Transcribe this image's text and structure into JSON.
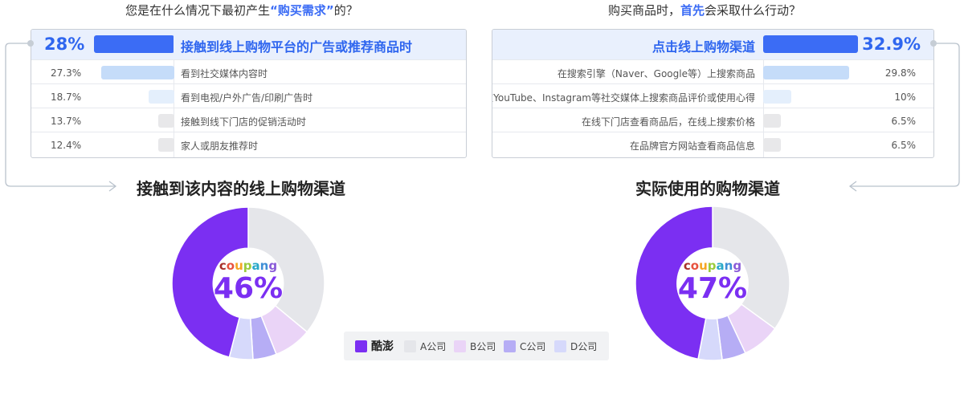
{
  "left": {
    "question_parts": [
      "您是在什么情况下最初产生",
      "“购买需求”",
      "的？"
    ],
    "top": {
      "pct": "28%",
      "value": 28,
      "label": "接触到线上购物平台的广告或推荐商品时"
    },
    "rows": [
      {
        "pct": "27.3%",
        "value": 27.3,
        "label": "看到社交媒体内容时"
      },
      {
        "pct": "18.7%",
        "value": 18.7,
        "label": "看到电视/户外广告/印刷广告时"
      },
      {
        "pct": "13.7%",
        "value": 13.7,
        "label": "接触到线下门店的促销活动时"
      },
      {
        "pct": "12.4%",
        "value": 12.4,
        "label": "家人或朋友推荐时"
      }
    ],
    "donut_title": "接触到该内容的线上购物渠道",
    "center_pct": "46%"
  },
  "right": {
    "question_parts": [
      "购买商品时，",
      "首先",
      "会采取什么行动？"
    ],
    "top": {
      "pct": "32.9%",
      "value": 32.9,
      "label": "点击线上购物渠道"
    },
    "rows": [
      {
        "pct": "29.8%",
        "value": 29.8,
        "label": "在搜索引擎（Naver、Google等）上搜索商品"
      },
      {
        "pct": "10%",
        "value": 10,
        "label": "在YouTube、Instagram等社交媒体上搜索商品评价或使用心得"
      },
      {
        "pct": "6.5%",
        "value": 6.5,
        "label": "在线下门店查看商品后，在线上搜索价格"
      },
      {
        "pct": "6.5%",
        "value": 6.5,
        "label": "在品牌官方网站查看商品信息"
      }
    ],
    "donut_title": "实际使用的购物渠道",
    "center_pct": "47%"
  },
  "logo": {
    "letters": [
      "c",
      "o",
      "u",
      "p",
      "a",
      "n",
      "g"
    ],
    "colors": [
      "#a7302b",
      "#e7523e",
      "#f5a623",
      "#9acb3c",
      "#2aa9c9",
      "#3f8fd6",
      "#8a5bd8"
    ]
  },
  "legend": [
    {
      "name": "酷澎",
      "color": "#7b2ff2"
    },
    {
      "name": "A公司",
      "color": "#e5e6ea"
    },
    {
      "name": "B公司",
      "color": "#ead4f7"
    },
    {
      "name": "C公司",
      "color": "#b6adf5"
    },
    {
      "name": "D公司",
      "color": "#d6d9fb"
    }
  ],
  "colors": {
    "accent": "#2f66ef",
    "highlight_bar": "#3b6cf5",
    "second_bar": "#c5dcf9",
    "third_bar": "#e4effc",
    "minor_bar": "#e8e8ea"
  },
  "chart_data": [
    {
      "type": "bar",
      "title": "您是在什么情况下最初产生“购买需求”的？",
      "categories": [
        "接触到线上购物平台的广告或推荐商品时",
        "看到社交媒体内容时",
        "看到电视/户外广告/印刷广告时",
        "接触到线下门店的促销活动时",
        "家人或朋友推荐时"
      ],
      "values": [
        28,
        27.3,
        18.7,
        13.7,
        12.4
      ],
      "unit": "%"
    },
    {
      "type": "bar",
      "title": "购买商品时，首先会采取什么行动？",
      "categories": [
        "点击线上购物渠道",
        "在搜索引擎（Naver、Google等）上搜索商品",
        "在YouTube、Instagram等社交媒体上搜索商品评价或使用心得",
        "在线下门店查看商品后，在线上搜索价格",
        "在品牌官方网站查看商品信息"
      ],
      "values": [
        32.9,
        29.8,
        10,
        6.5,
        6.5
      ],
      "unit": "%"
    },
    {
      "type": "pie",
      "title": "接触到该内容的线上购物渠道",
      "categories": [
        "酷澎",
        "A公司",
        "B公司",
        "C公司",
        "D公司"
      ],
      "values": [
        46,
        36,
        8,
        5,
        5
      ],
      "center_label": "46%"
    },
    {
      "type": "pie",
      "title": "实际使用的购物渠道",
      "categories": [
        "酷澎",
        "A公司",
        "B公司",
        "C公司",
        "D公司"
      ],
      "values": [
        47,
        35,
        8,
        5,
        5
      ],
      "center_label": "47%"
    }
  ]
}
